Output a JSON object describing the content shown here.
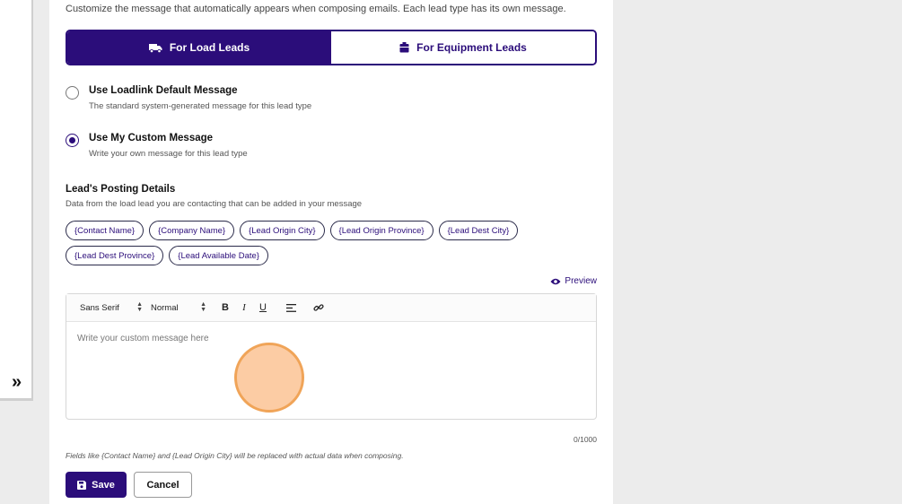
{
  "intro_text": "Customize the message that automatically appears when composing emails. Each lead type has its own message.",
  "lead_toggle": {
    "load_label": "For Load Leads",
    "equipment_label": "For Equipment Leads",
    "active": "load",
    "load_icon": "truck-icon",
    "equipment_icon": "package-icon"
  },
  "options": {
    "default": {
      "title": "Use Loadlink Default Message",
      "description": "The standard system-generated message for this lead type",
      "checked": false
    },
    "custom": {
      "title": "Use My Custom Message",
      "description": "Write your own message for this lead type",
      "checked": true
    }
  },
  "posting_details": {
    "title": "Lead's Posting Details",
    "description": "Data from the load lead you are contacting that can be added in your message",
    "chips": [
      "{Contact Name}",
      "{Company Name}",
      "{Lead Origin City}",
      "{Lead Origin Province}",
      "{Lead Dest City}",
      "{Lead Dest Province}",
      "{Lead Available Date}"
    ]
  },
  "preview_label": "Preview",
  "editor": {
    "font_select": "Sans Serif",
    "size_select": "Normal",
    "placeholder": "Write your custom message here",
    "value": ""
  },
  "counter": "0/1000",
  "hint": "Fields like {Contact Name} and {Lead Origin City} will be replaced with actual data when composing.",
  "buttons": {
    "save": "Save",
    "cancel": "Cancel"
  },
  "colors": {
    "primary": "#2b0d7a",
    "cursor_fill": "#fccaa0",
    "cursor_border": "#f0a050"
  }
}
